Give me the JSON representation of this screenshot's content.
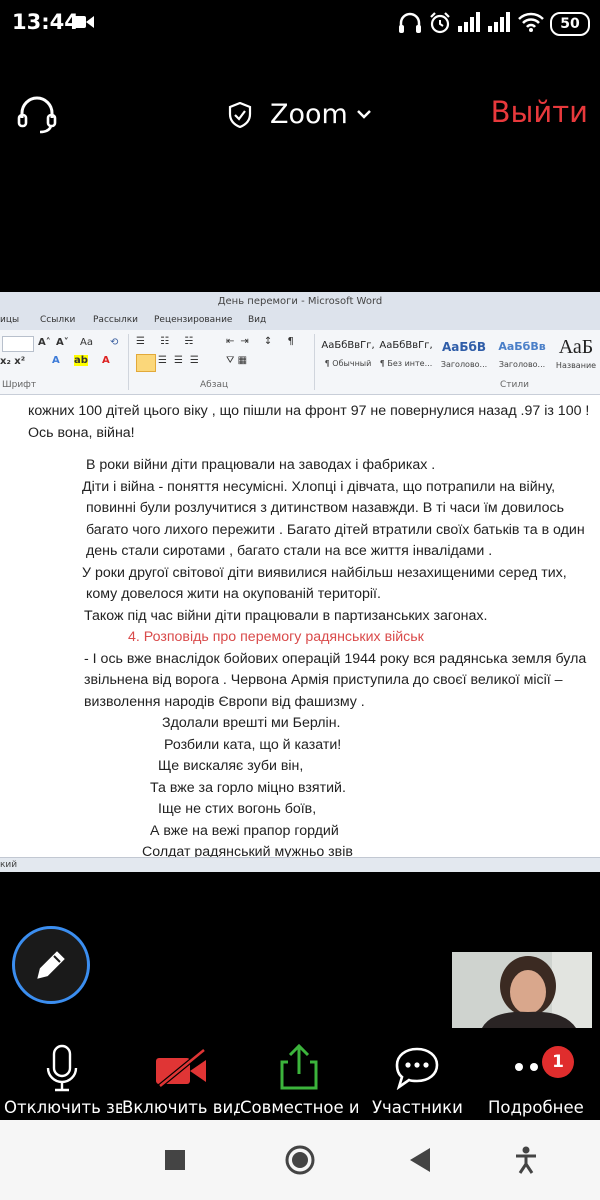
{
  "status_bar": {
    "time": "13:44",
    "battery": "50"
  },
  "header": {
    "title": "Zoom",
    "leave_label": "Выйти"
  },
  "word": {
    "window_title": "День перемоги  -  Microsoft Word",
    "tabs": [
      "ицы",
      "Ссылки",
      "Рассылки",
      "Рецензирование",
      "Вид"
    ],
    "ribbon": {
      "font_group": "Шрифт",
      "paragraph_group": "Абзац",
      "styles_group": "Стили",
      "styles": [
        {
          "sample": "АаБбВвГг,",
          "name": "¶ Обычный"
        },
        {
          "sample": "АаБбВвГг,",
          "name": "¶ Без инте..."
        },
        {
          "sample": "АаБбВ",
          "name": "Заголово..."
        },
        {
          "sample": "АаБбВв",
          "name": "Заголово..."
        },
        {
          "sample": "АаБ",
          "name": "Название"
        }
      ]
    },
    "document_lines": [
      "кожних 100 дітей цього віку , що пішли на фронт 97 не повернулися назад .97 із 100 !",
      "Ось вона, війна!",
      "В роки війни  діти працювали на заводах і фабриках .",
      " Діти і війна - поняття несумісні. Хлопці і дівчата, що потрапили на війну,",
      "повинні були розлучитися з дитинством назавжди. В ті часи їм довилось",
      "багато чого лихого пережити . Багато дітей втратили своїх батьків та в один",
      "день стали сиротами , багато стали на все життя  інвалідами .",
      " У роки другої світової діти виявилися найбільш незахищеними серед тих,",
      "кому довелося жити на окупованій території.",
      "  Також  під час війни діти працювали в партизанських загонах.",
      "4. Розповідь про перемогу радянських військ",
      "- І ось вже внаслідок бойових операцій 1944 року вся радянська земля була",
      "звільнена від ворога . Червона Армія приступила до своєї великої місії –",
      "визволення народів Європи від фашизму .",
      "Здолали врешті ми Берлін.",
      "Розбили ката, що й казати!",
      "Ще вискаляє зуби він,",
      "Та вже за горло міцно взятий.",
      "Іще не стих вогонь боїв,",
      "А вже на вежі прапор гордий",
      "Солдат радянський мужньо звів"
    ],
    "status_text": "кий"
  },
  "toolbar": {
    "items": [
      {
        "label": "Отключить звук"
      },
      {
        "label": "Включить видео"
      },
      {
        "label": "Совместное использование"
      },
      {
        "label": "Участники"
      },
      {
        "label": "Подробнее"
      }
    ],
    "more_badge": "1"
  },
  "colors": {
    "leave": "#e8393c",
    "share_green": "#3cb43c",
    "video_red": "#e03535",
    "annotate_blue": "#3b8ef0"
  },
  "icons": [
    "headset-icon",
    "shield-icon",
    "chevron-down-icon",
    "pencil-icon",
    "microphone-icon",
    "video-off-icon",
    "share-icon",
    "chat-bubble-icon",
    "more-dots-icon",
    "stop-square-icon",
    "home-circle-icon",
    "back-triangle-icon",
    "accessibility-icon"
  ]
}
